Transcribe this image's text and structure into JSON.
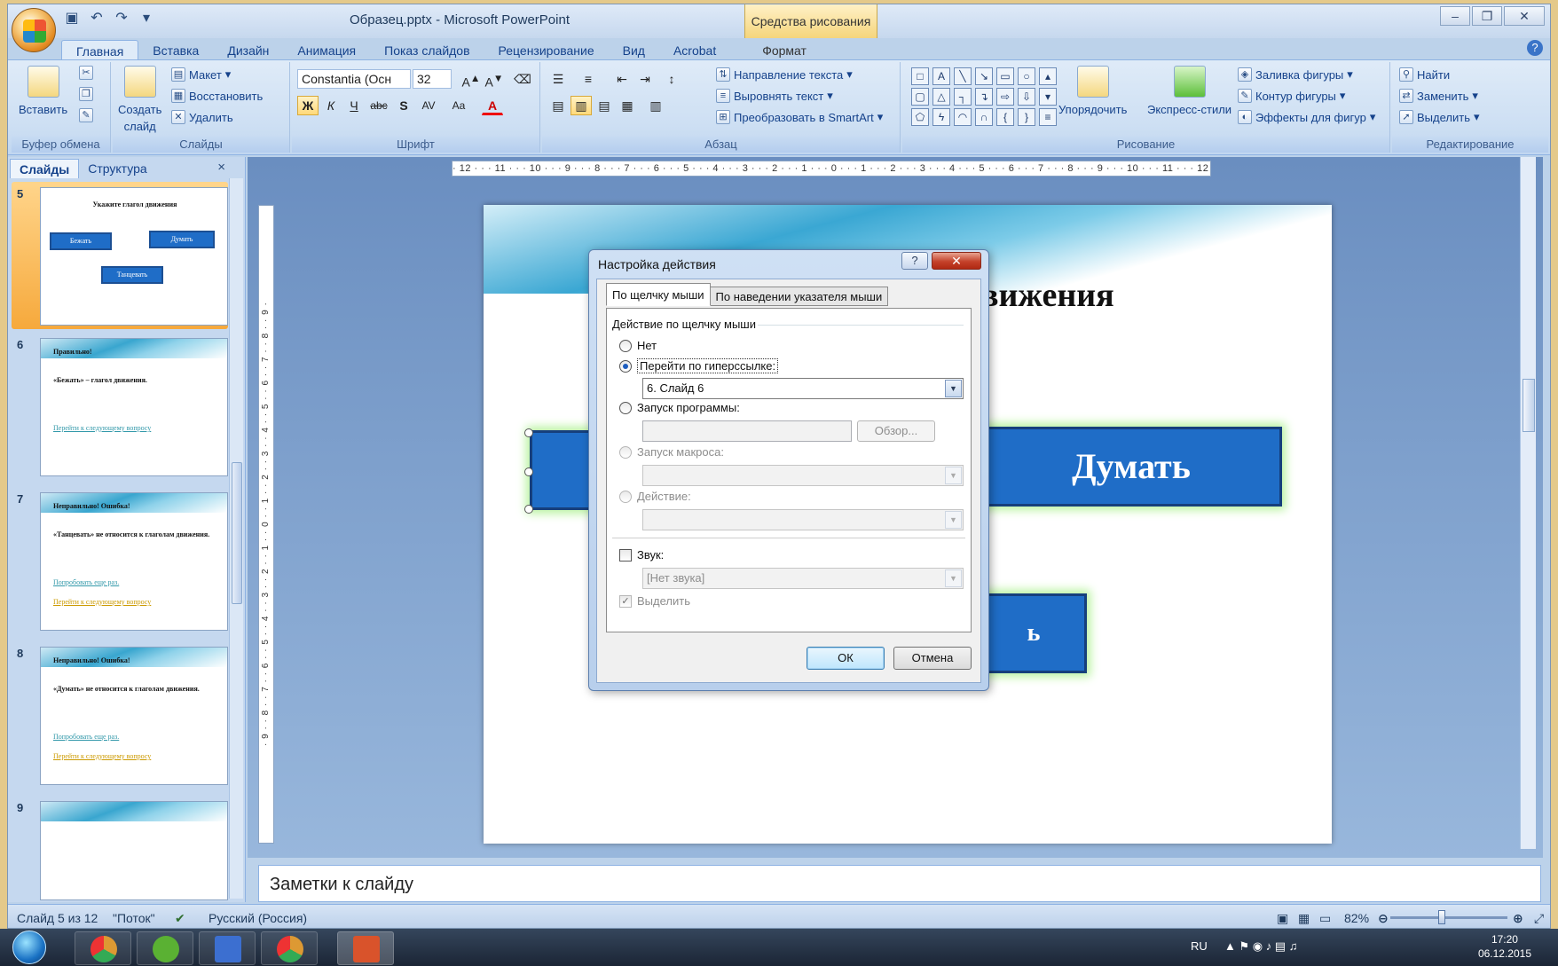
{
  "window": {
    "title": "Образец.pptx - Microsoft PowerPoint",
    "context_tab_header": "Средства рисования",
    "controls": {
      "minimize": "–",
      "restore": "❐",
      "close": "✕"
    }
  },
  "ribbon_tabs": [
    "Главная",
    "Вставка",
    "Дизайн",
    "Анимация",
    "Показ слайдов",
    "Рецензирование",
    "Вид",
    "Acrobat",
    "Формат"
  ],
  "ribbon": {
    "clipboard": {
      "label": "Буфер обмена",
      "paste": "Вставить"
    },
    "slides": {
      "label": "Слайды",
      "create": "Создать",
      "create2": "слайд",
      "layout": "Макет",
      "reset": "Восстановить",
      "delete": "Удалить"
    },
    "font": {
      "label": "Шрифт",
      "family": "Constantia (Осн",
      "size": "32",
      "bold": "Ж",
      "italic": "К",
      "underline": "Ч",
      "strike": "abc",
      "shadow": "S",
      "spacing": "AV",
      "case": "Aa"
    },
    "paragraph": {
      "label": "Абзац",
      "text_direction": "Направление текста",
      "align_text": "Выровнять текст",
      "smartart": "Преобразовать в SmartArt"
    },
    "drawing": {
      "label": "Рисование",
      "arrange": "Упорядочить",
      "quick_styles": "Экспресс-стили",
      "fill": "Заливка фигуры",
      "outline": "Контур фигуры",
      "effects": "Эффекты для фигур"
    },
    "editing": {
      "label": "Редактирование",
      "find": "Найти",
      "replace": "Заменить",
      "select": "Выделить"
    }
  },
  "left_pane": {
    "tabs": [
      "Слайды",
      "Структура"
    ],
    "close": "×",
    "thumbnails": [
      {
        "num": "5",
        "title": "Укажите глагол движения",
        "buttons": [
          "Бежать",
          "Думать",
          "Танцевать"
        ]
      },
      {
        "num": "6",
        "title": "Правильно!",
        "body": "«Бежать» – глагол движения.",
        "link1": "Перейти к следующему вопросу"
      },
      {
        "num": "7",
        "title": "Неправильно! Ошибка!",
        "body": "«Танцевать» не относится к глаголам движения.",
        "link1": "Попробовать еще раз.",
        "link2": "Перейти к следующему вопросу"
      },
      {
        "num": "8",
        "title": "Неправильно! Ошибка!",
        "body": "«Думать» не относится к глаголам движения.",
        "link1": "Попробовать еще раз.",
        "link2": "Перейти к следующему вопросу"
      },
      {
        "num": "9"
      }
    ]
  },
  "ruler": {
    "horizontal": "· 12 · · · 11 · · · 10 · · · 9 · · · 8 · · · 7 · · · 6 · · · 5 · · · 4 · · · 3 · · · 2 · · · 1 · · · 0 · · · 1 · · · 2 · · · 3 · · · 4 · · · 5 · · · 6 · · · 7 · · · 8 · · · 9 · · · 10 · · · 11 · · · 12 ·",
    "vertical": "· 9 · · 8 · · 7 · · 6 · · 5 · · 4 · · 3 · · 2 · · 1 · · 0 · · 1 · · 2 · · 3 · · 4 · · 5 · · 6 · · 7 · · 8 · · 9 ·"
  },
  "slide": {
    "heading_fragment": "вижения",
    "button_think": "Думать",
    "button_partial": "ь"
  },
  "notes_placeholder": "Заметки к слайду",
  "dialog": {
    "title": "Настройка действия",
    "help": "?",
    "close": "✕",
    "tabs": [
      "По щелчку мыши",
      "По наведении указателя мыши"
    ],
    "group_title": "Действие по щелчку мыши",
    "options": {
      "none": "Нет",
      "hyperlink": "Перейти по гиперссылке:",
      "hyperlink_value": "6. Слайд 6",
      "run_program": "Запуск программы:",
      "browse": "Обзор...",
      "run_macro": "Запуск макроса:",
      "action": "Действие:",
      "sound": "Звук:",
      "sound_value": "[Нет звука]",
      "highlight": "Выделить"
    },
    "ok": "ОК",
    "cancel": "Отмена"
  },
  "status_bar": {
    "slide_info": "Слайд 5 из 12",
    "theme": "\"Поток\"",
    "language": "Русский (Россия)",
    "zoom": "82%"
  },
  "taskbar": {
    "lang": "RU",
    "time": "17:20",
    "date": "06.12.2015"
  },
  "colors": {
    "slide_button": "#1f6dc7",
    "selected_thumb": "#f6a93c",
    "ribbon_bg": "#cddff3"
  }
}
